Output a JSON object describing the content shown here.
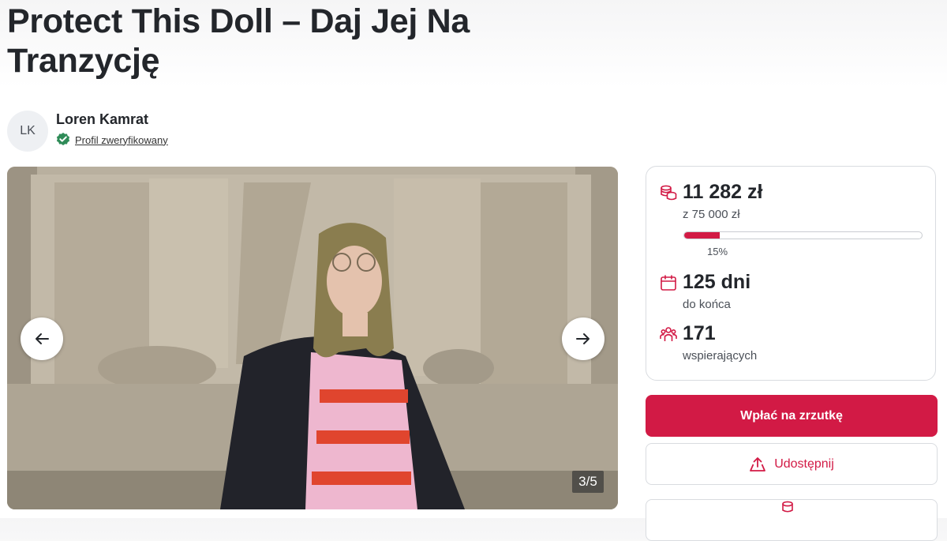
{
  "campaign": {
    "title": "Protect This Doll – Daj Jej Na Tranzycję"
  },
  "author": {
    "initials": "LK",
    "name": "Loren Kamrat",
    "verified_label": "Profil zweryfikowany",
    "verified_icon": "verified-check-icon"
  },
  "gallery": {
    "counter": "3/5",
    "prev_icon": "arrow-left-icon",
    "next_icon": "arrow-right-icon"
  },
  "stats": {
    "raised": "11 282 zł",
    "goal": "z 75 000 zł",
    "progress_percent": 15,
    "progress_label": "15%",
    "days": "125 dni",
    "days_label": "do końca",
    "supporters": "171",
    "supporters_label": "wspierających",
    "icons": [
      "coins-icon",
      "calendar-icon",
      "people-icon"
    ]
  },
  "actions": {
    "donate_label": "Wpłać na zrzutkę",
    "share_label": "Udostępnij"
  },
  "colors": {
    "accent": "#d21a45",
    "verified": "#2e8b57"
  }
}
